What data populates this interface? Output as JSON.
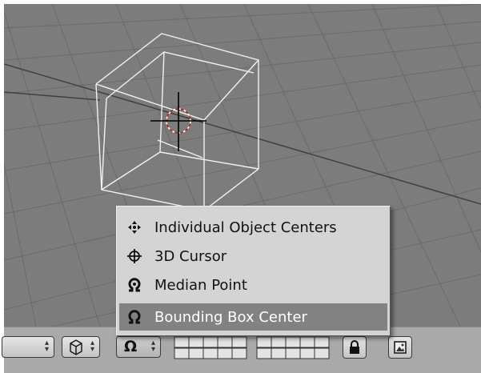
{
  "pivot_menu": {
    "items": [
      {
        "label": "Individual Object Centers",
        "icon": "individual-centers-icon",
        "active": false
      },
      {
        "label": "3D Cursor",
        "icon": "3d-cursor-icon",
        "active": false
      },
      {
        "label": "Median Point",
        "icon": "median-point-icon",
        "active": false
      },
      {
        "label": "Bounding Box Center",
        "icon": "bounding-box-center-icon",
        "active": true
      }
    ]
  },
  "colors": {
    "viewport_bg": "#7c7c7c",
    "grid_line": "#6e6e6e",
    "wireframe": "#f2f2f2",
    "header_bg": "#a9a9a9",
    "menu_bg": "#d4d4d4",
    "menu_highlight": "#828282"
  }
}
